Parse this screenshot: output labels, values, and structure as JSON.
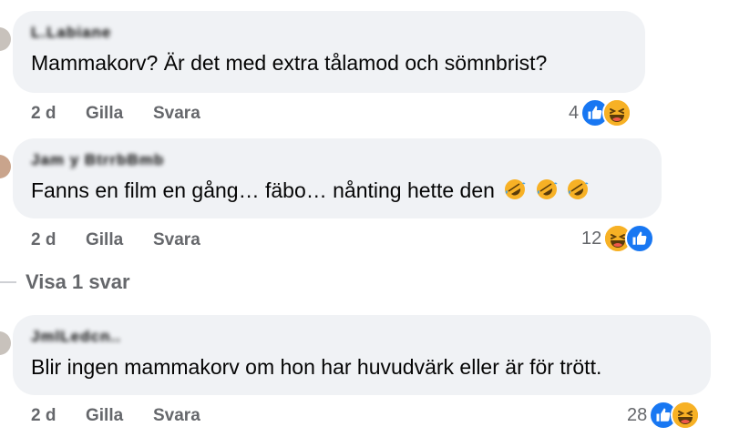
{
  "comments": [
    {
      "author": "L.Labiane",
      "text": "Mammakorv? Är det med extra tålamod och sömnbrist?",
      "time": "2 d",
      "like_label": "Gilla",
      "reply_label": "Svara",
      "reaction_count": "4",
      "reactions": [
        "like",
        "haha"
      ]
    },
    {
      "author": "Jam y BtrrbBmb",
      "text": "Fanns en film en gång… fäbo… nånting hette den",
      "emojis": [
        "rofl-emoji",
        "rofl-emoji",
        "rofl-emoji"
      ],
      "time": "2 d",
      "like_label": "Gilla",
      "reply_label": "Svara",
      "reaction_count": "12",
      "reactions": [
        "haha",
        "like"
      ]
    },
    {
      "author": "JmlLedcn..",
      "text": "Blir ingen mammakorv om hon har huvudvärk eller är för trött.",
      "time": "2 d",
      "like_label": "Gilla",
      "reply_label": "Svara",
      "reaction_count": "28",
      "reactions": [
        "like",
        "haha"
      ]
    }
  ],
  "view_replies_label": "Visa 1 svar",
  "colors": {
    "bubble": "#f0f2f5",
    "meta": "#65676b",
    "like_blue": "#1877f2",
    "haha_yellow": "#f7b125"
  }
}
